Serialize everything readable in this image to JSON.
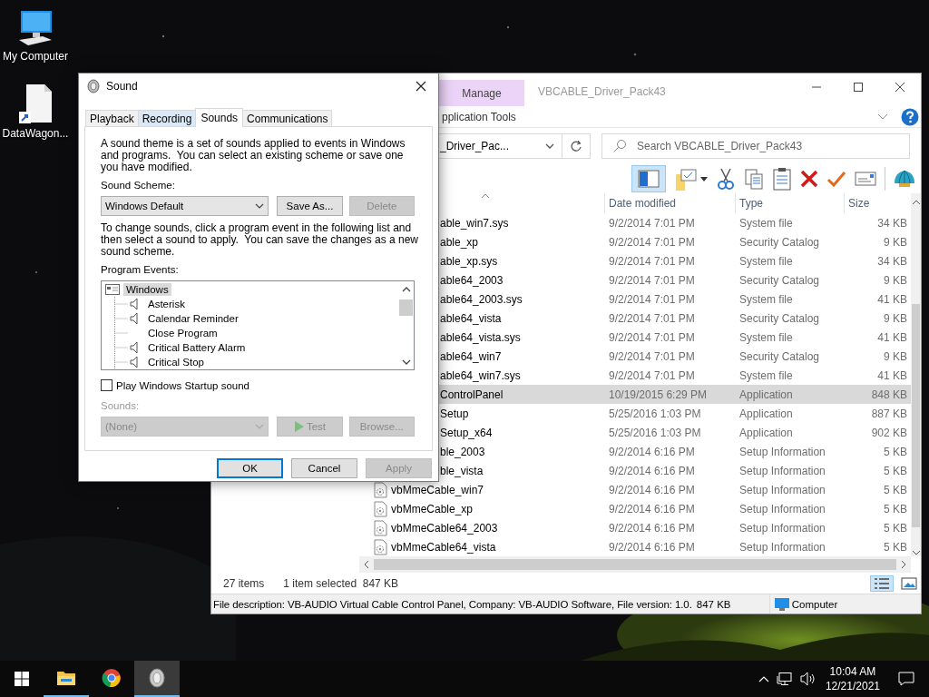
{
  "desktop": {
    "icons": [
      {
        "label": "My Computer",
        "kind": "computer"
      },
      {
        "label": "DataWagon...",
        "kind": "shortcut-document"
      }
    ]
  },
  "explorer": {
    "title": "VBCABLE_Driver_Pack43",
    "ribbon_tab": {
      "label": "Manage",
      "kind": "contextual"
    },
    "ribbon_group": "pplication Tools",
    "address": "_Driver_Pac...",
    "search": {
      "placeholder": "Search VBCABLE_Driver_Pack43"
    },
    "columns": [
      "Date modified",
      "Type",
      "Size"
    ],
    "rows": [
      {
        "name": "able_win7.sys",
        "date": "9/2/2014 7:01 PM",
        "type": "System file",
        "size": "34 KB",
        "selected": false
      },
      {
        "name": "able_xp",
        "date": "9/2/2014 7:01 PM",
        "type": "Security Catalog",
        "size": "9 KB",
        "selected": false
      },
      {
        "name": "able_xp.sys",
        "date": "9/2/2014 7:01 PM",
        "type": "System file",
        "size": "34 KB",
        "selected": false
      },
      {
        "name": "able64_2003",
        "date": "9/2/2014 7:01 PM",
        "type": "Security Catalog",
        "size": "9 KB",
        "selected": false
      },
      {
        "name": "able64_2003.sys",
        "date": "9/2/2014 7:01 PM",
        "type": "System file",
        "size": "41 KB",
        "selected": false
      },
      {
        "name": "able64_vista",
        "date": "9/2/2014 7:01 PM",
        "type": "Security Catalog",
        "size": "9 KB",
        "selected": false
      },
      {
        "name": "able64_vista.sys",
        "date": "9/2/2014 7:01 PM",
        "type": "System file",
        "size": "41 KB",
        "selected": false
      },
      {
        "name": "able64_win7",
        "date": "9/2/2014 7:01 PM",
        "type": "Security Catalog",
        "size": "9 KB",
        "selected": false
      },
      {
        "name": "able64_win7.sys",
        "date": "9/2/2014 7:01 PM",
        "type": "System file",
        "size": "41 KB",
        "selected": false
      },
      {
        "name": "ControlPanel",
        "date": "10/19/2015 6:29 PM",
        "type": "Application",
        "size": "848 KB",
        "selected": true
      },
      {
        "name": "Setup",
        "date": "5/25/2016 1:03 PM",
        "type": "Application",
        "size": "887 KB",
        "selected": false
      },
      {
        "name": "Setup_x64",
        "date": "5/25/2016 1:03 PM",
        "type": "Application",
        "size": "902 KB",
        "selected": false
      },
      {
        "name": "ble_2003",
        "date": "9/2/2014 6:16 PM",
        "type": "Setup Information",
        "size": "5 KB",
        "selected": false
      },
      {
        "name": "ble_vista",
        "date": "9/2/2014 6:16 PM",
        "type": "Setup Information",
        "size": "5 KB",
        "selected": false
      },
      {
        "name": "vbMmeCable_win7",
        "date": "9/2/2014 6:16 PM",
        "type": "Setup Information",
        "size": "5 KB",
        "selected": false,
        "kind": "setup-info"
      },
      {
        "name": "vbMmeCable_xp",
        "date": "9/2/2014 6:16 PM",
        "type": "Setup Information",
        "size": "5 KB",
        "selected": false,
        "kind": "setup-info"
      },
      {
        "name": "vbMmeCable64_2003",
        "date": "9/2/2014 6:16 PM",
        "type": "Setup Information",
        "size": "5 KB",
        "selected": false,
        "kind": "setup-info"
      },
      {
        "name": "vbMmeCable64_vista",
        "date": "9/2/2014 6:16 PM",
        "type": "Setup Information",
        "size": "5 KB",
        "selected": false,
        "kind": "setup-info"
      }
    ],
    "status": {
      "items": "27 items",
      "selection": "1 item selected  847 KB"
    },
    "details": {
      "description": "File description: VB-AUDIO Virtual Cable Control Panel, Company: VB-AUDIO Software, File version: 1.0.",
      "size": "847 KB",
      "location": "Computer"
    }
  },
  "sound_dialog": {
    "title": "Sound",
    "tabs": [
      {
        "label": "Playback",
        "selected": false
      },
      {
        "label": "Recording",
        "selected": false
      },
      {
        "label": "Sounds",
        "selected": true
      },
      {
        "label": "Communications",
        "selected": false
      }
    ],
    "intro": "A sound theme is a set of sounds applied to events in Windows and programs.  You can select an existing scheme or save one you have modified.",
    "scheme_label": "Sound Scheme:",
    "scheme": {
      "value": "Windows Default",
      "disabled": false
    },
    "scheme_buttons": [
      {
        "label": "Save As...",
        "disabled": false
      },
      {
        "label": "Delete",
        "disabled": true
      }
    ],
    "help": "To change sounds, click a program event in the following list and then select a sound to apply.  You can save the changes as a new sound scheme.",
    "events_label": "Program Events:",
    "events": [
      {
        "label": "Windows",
        "selected": true,
        "children": [
          {
            "label": "Asterisk",
            "sound": true
          },
          {
            "label": "Calendar Reminder",
            "sound": true
          },
          {
            "label": "Close Program",
            "sound": false
          },
          {
            "label": "Critical Battery Alarm",
            "sound": true
          },
          {
            "label": "Critical Stop",
            "sound": true
          }
        ]
      }
    ],
    "startup": {
      "label": "Play Windows Startup sound",
      "checked": false
    },
    "sounds": {
      "label": "Sounds:",
      "value": "(None)",
      "disabled": true
    },
    "sound_buttons": [
      {
        "label": "Test",
        "kind": "test",
        "disabled": true
      },
      {
        "label": "Browse...",
        "kind": "plain",
        "disabled": true
      }
    ],
    "footer_buttons": [
      {
        "label": "OK",
        "default": true,
        "disabled": false
      },
      {
        "label": "Cancel",
        "default": false,
        "disabled": false
      },
      {
        "label": "Apply",
        "default": false,
        "disabled": true
      }
    ]
  },
  "taskbar": {
    "apps": [
      {
        "kind": "explorer",
        "running": true,
        "selected": false
      },
      {
        "kind": "browser",
        "running": false,
        "selected": false
      },
      {
        "kind": "sound",
        "running": true,
        "selected": true
      }
    ],
    "clock": {
      "time": "10:04 AM",
      "date": "12/21/2021"
    }
  }
}
